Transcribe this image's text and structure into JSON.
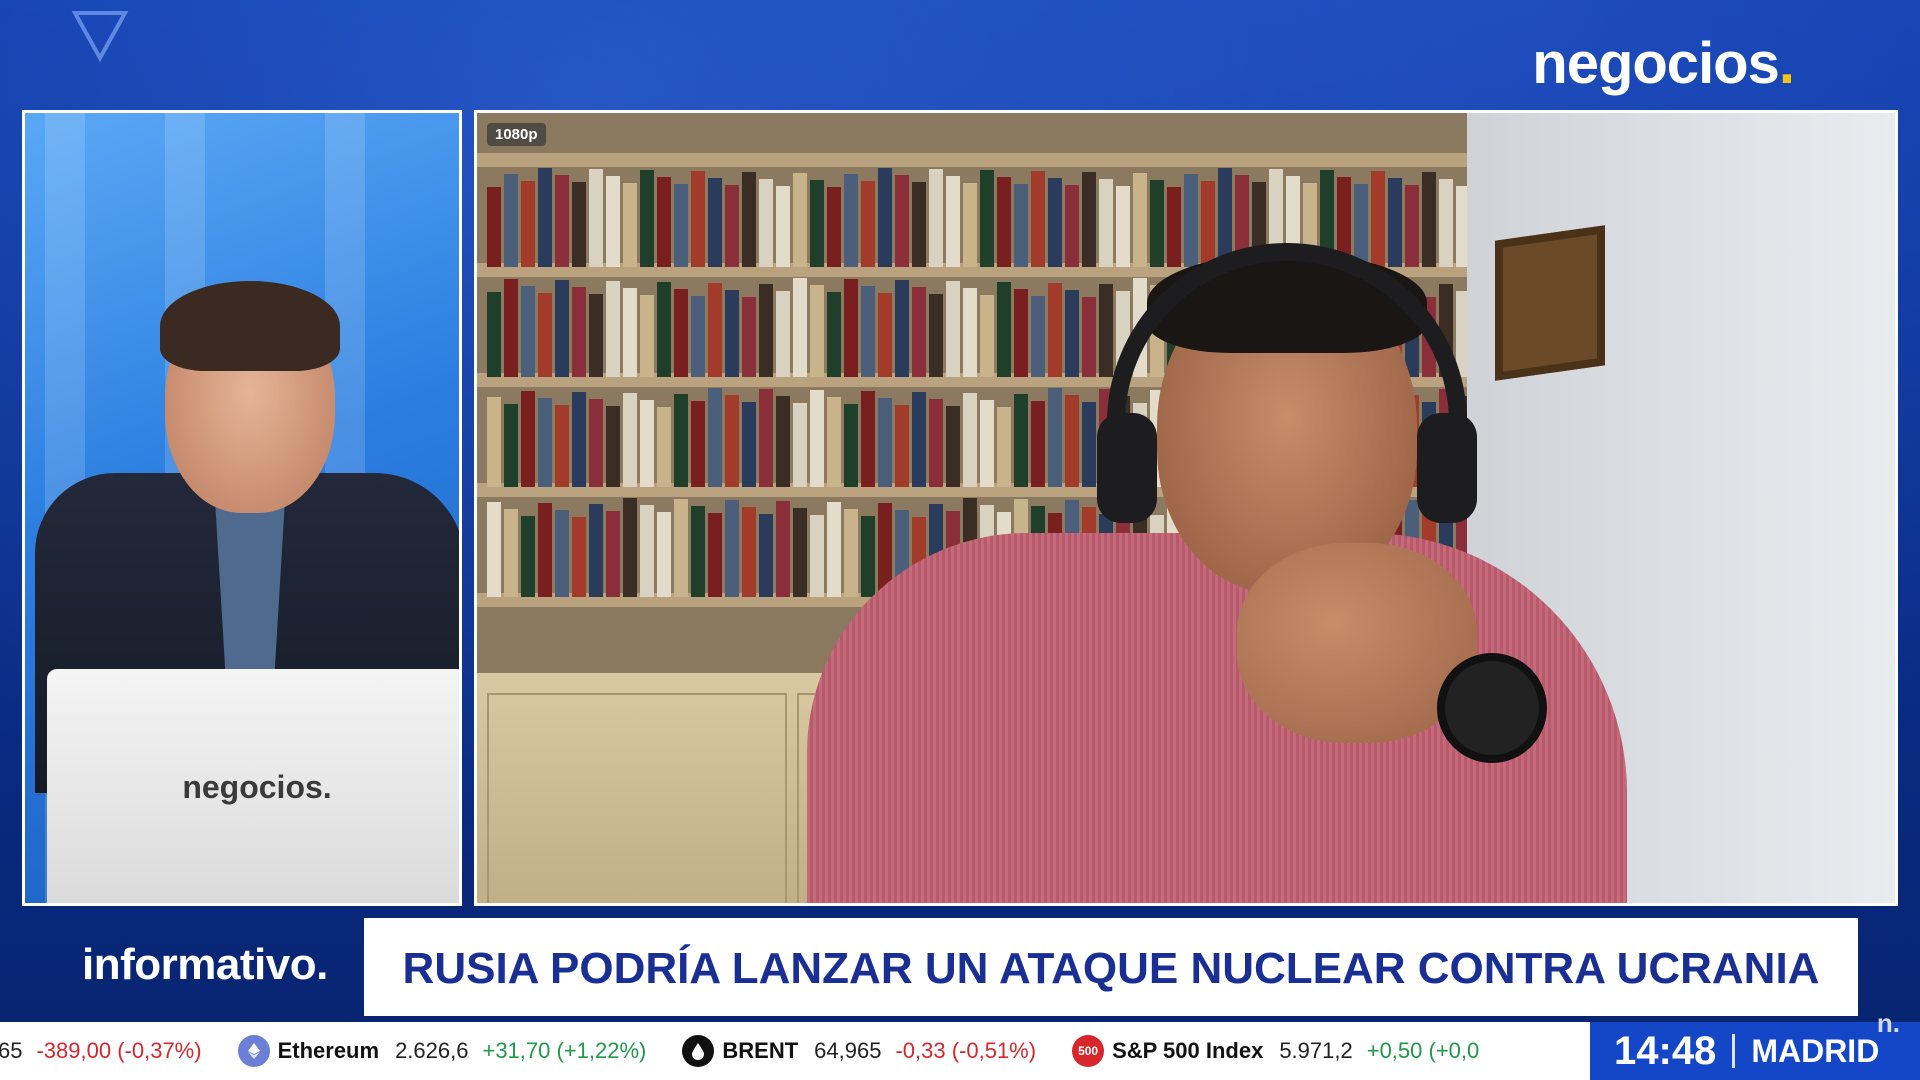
{
  "brand": {
    "name": "negocios",
    "dot": ".",
    "accent": "#f2c41a",
    "background": "#0b2f8c"
  },
  "host_panel": {
    "desk_logo": "negocios."
  },
  "guest_panel": {
    "resolution_badge": "1080p"
  },
  "lower_third": {
    "program": "informativo.",
    "headline": "RUSIA PODRÍA LANZAR UN ATAQUE NUCLEAR CONTRA UCRANIA",
    "headline_color": "#1a2f94"
  },
  "ticker": {
    "items": [
      {
        "name": "",
        "price": "65",
        "change": "-389,00 (-0,37%)",
        "direction": "neg",
        "icon": ""
      },
      {
        "name": "Ethereum",
        "price": "2.626,6",
        "change": "+31,70 (+1,22%)",
        "direction": "pos",
        "icon": "ethereum-icon"
      },
      {
        "name": "BRENT",
        "price": "64,965",
        "change": "-0,33 (-0,51%)",
        "direction": "neg",
        "icon": "oil-drop-icon"
      },
      {
        "name": "S&P 500 Index",
        "price": "5.971,2",
        "change": "+0,50 (+0,0",
        "direction": "pos",
        "icon": "sp500-badge-icon",
        "icon_text": "500"
      }
    ]
  },
  "clock": {
    "time": "14:48",
    "city": "MADRID"
  },
  "corner_logo": "n."
}
